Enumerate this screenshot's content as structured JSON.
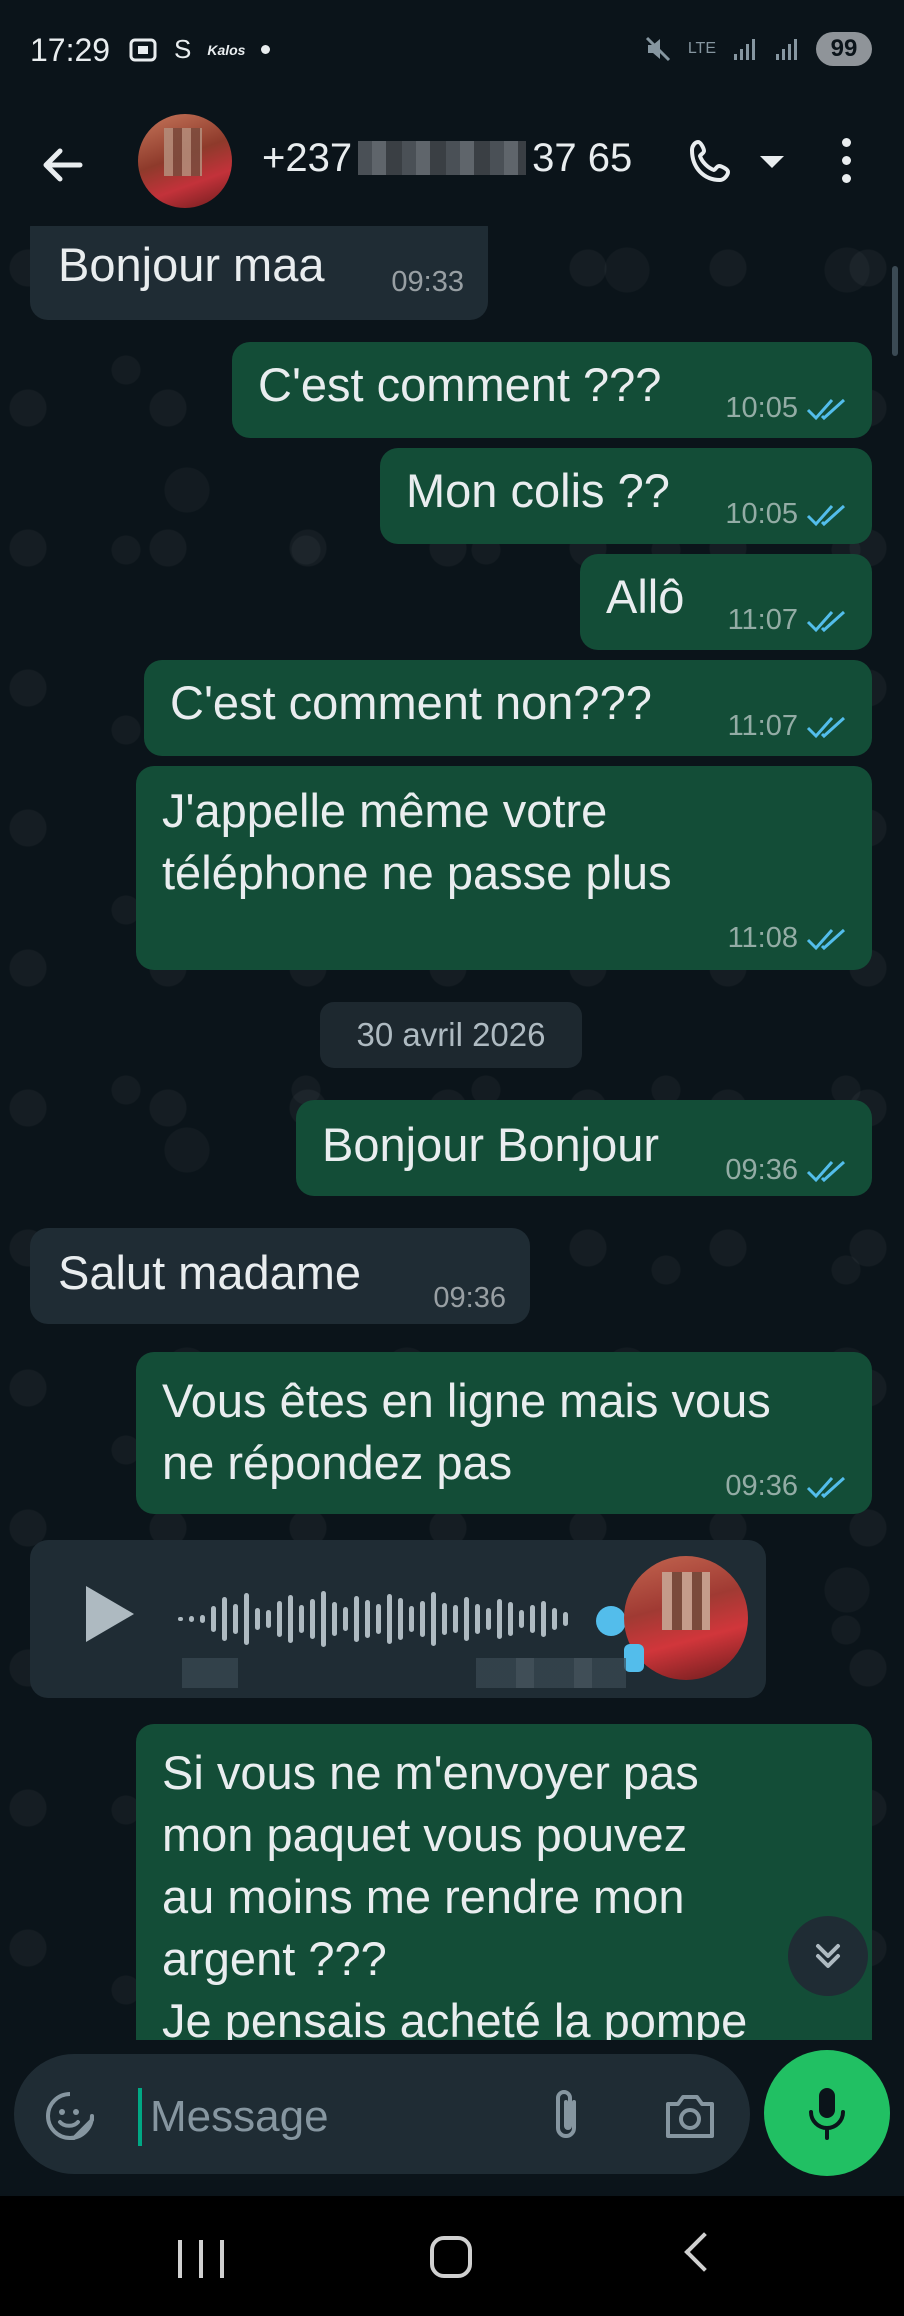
{
  "status_bar": {
    "time": "17:29",
    "icon_s": "S",
    "brand": "Kalos",
    "network": "LTE",
    "battery": "99"
  },
  "header": {
    "contact_prefix": "+237",
    "contact_suffix": "37 65"
  },
  "messages": [
    {
      "text": "Bonjour maa",
      "time": "09:33",
      "dir": "in"
    },
    {
      "text": "C'est comment ???",
      "time": "10:05",
      "dir": "out"
    },
    {
      "text": "Mon colis ??",
      "time": "10:05",
      "dir": "out"
    },
    {
      "text": "Allô",
      "time": "11:07",
      "dir": "out"
    },
    {
      "text": "C'est comment non???",
      "time": "11:07",
      "dir": "out"
    },
    {
      "text": "J'appelle même votre\ntéléphone ne passe plus",
      "time": "11:08",
      "dir": "out"
    },
    {
      "text": "Bonjour Bonjour",
      "time": "09:36",
      "dir": "out"
    },
    {
      "text": "Salut madame",
      "time": "09:36",
      "dir": "in"
    },
    {
      "text": "Vous êtes en ligne mais vous\nne répondez pas",
      "time": "09:36",
      "dir": "out"
    },
    {
      "text": "Si vous ne m'envoyer pas\nmon paquet vous pouvez\nau moins me rendre mon\nargent ???\nJe pensais acheté la pompe",
      "time": "",
      "dir": "out"
    }
  ],
  "date_separator": "30 avril 2026",
  "composer": {
    "placeholder": "Message"
  },
  "colors": {
    "outgoing_bubble": "#134d37",
    "incoming_bubble": "#1f2c34",
    "read_ticks": "#53bdeb",
    "mic_button": "#21c063"
  },
  "icons": [
    "back-arrow-icon",
    "phone-icon",
    "dropdown-caret-icon",
    "more-vert-icon",
    "play-icon",
    "double-chevron-down-icon",
    "sticker-icon",
    "paperclip-icon",
    "camera-icon",
    "microphone-icon"
  ]
}
